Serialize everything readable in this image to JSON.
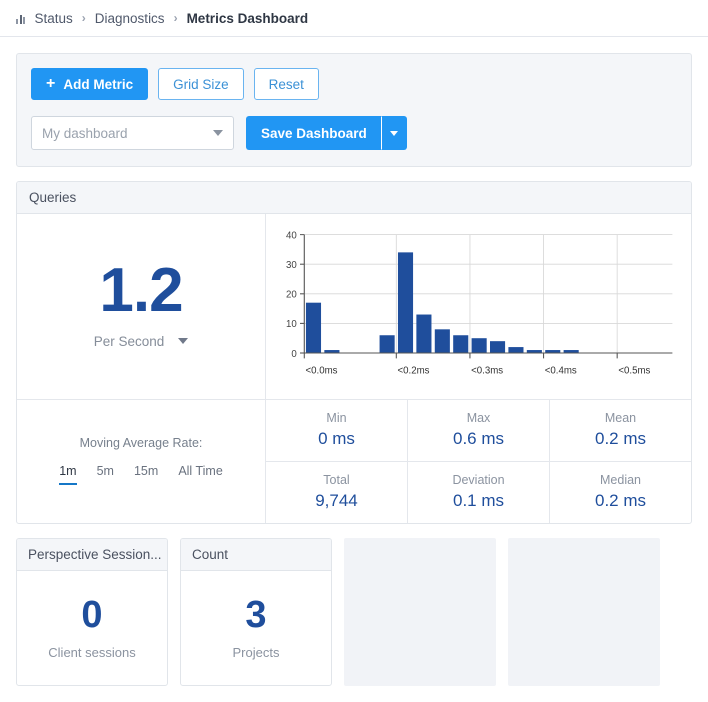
{
  "breadcrumb": {
    "icon": "bar-chart-icon",
    "items": [
      "Status",
      "Diagnostics"
    ],
    "separator": "›",
    "current": "Metrics Dashboard"
  },
  "toolbar": {
    "add_metric_label": "Add Metric",
    "add_metric_icon": "plus-icon",
    "grid_size_label": "Grid Size",
    "reset_label": "Reset",
    "dashboard_select_value": "My dashboard",
    "dashboard_select_placeholder": "My dashboard",
    "save_dashboard_label": "Save Dashboard",
    "save_dropdown_icon": "chevron-down-icon"
  },
  "queries_panel": {
    "title": "Queries",
    "rate": {
      "value": "1.2",
      "unit_label": "Per Second",
      "unit_dropdown_icon": "chevron-down-icon"
    },
    "moving_average": {
      "title": "Moving Average Rate:",
      "tabs": [
        {
          "label": "1m",
          "active": true
        },
        {
          "label": "5m",
          "active": false
        },
        {
          "label": "15m",
          "active": false
        },
        {
          "label": "All Time",
          "active": false
        }
      ]
    },
    "stats": [
      {
        "label": "Min",
        "value": "0 ms"
      },
      {
        "label": "Max",
        "value": "0.6 ms"
      },
      {
        "label": "Mean",
        "value": "0.2 ms"
      },
      {
        "label": "Total",
        "value": "9,744"
      },
      {
        "label": "Deviation",
        "value": "0.1 ms"
      },
      {
        "label": "Median",
        "value": "0.2 ms"
      }
    ]
  },
  "cards": [
    {
      "title": "Perspective Session...",
      "number": "0",
      "label": "Client sessions",
      "empty": false
    },
    {
      "title": "Count",
      "number": "3",
      "label": "Projects",
      "empty": false
    },
    {
      "empty": true
    },
    {
      "empty": true
    }
  ],
  "colors": {
    "accent_blue": "#2196f3",
    "bar_blue": "#1f4e9c",
    "value_blue": "#1f4e9c",
    "panel_header_bg": "#f4f6f9",
    "border": "#e1e5ea",
    "muted_text": "#8b93a0",
    "placeholder_bg": "#f1f3f7",
    "active_tab_underline": "#1577c7"
  },
  "chart_data": {
    "type": "bar",
    "title": "",
    "xlabel": "",
    "ylabel": "",
    "ylim": [
      0,
      40
    ],
    "yticks": [
      0,
      10,
      20,
      30,
      40
    ],
    "grid": true,
    "legend": "none",
    "tick_labels": [
      "<0.0ms",
      "<0.2ms",
      "<0.3ms",
      "<0.4ms",
      "<0.5ms"
    ],
    "tick_label_bins": [
      0,
      5,
      9,
      13,
      17
    ],
    "bin_count": 20,
    "bar_color": "#1f4e9c",
    "values": [
      17,
      1,
      0,
      0,
      6,
      34,
      13,
      8,
      6,
      5,
      4,
      2,
      1,
      1,
      1,
      0,
      0,
      0,
      0,
      0
    ]
  }
}
